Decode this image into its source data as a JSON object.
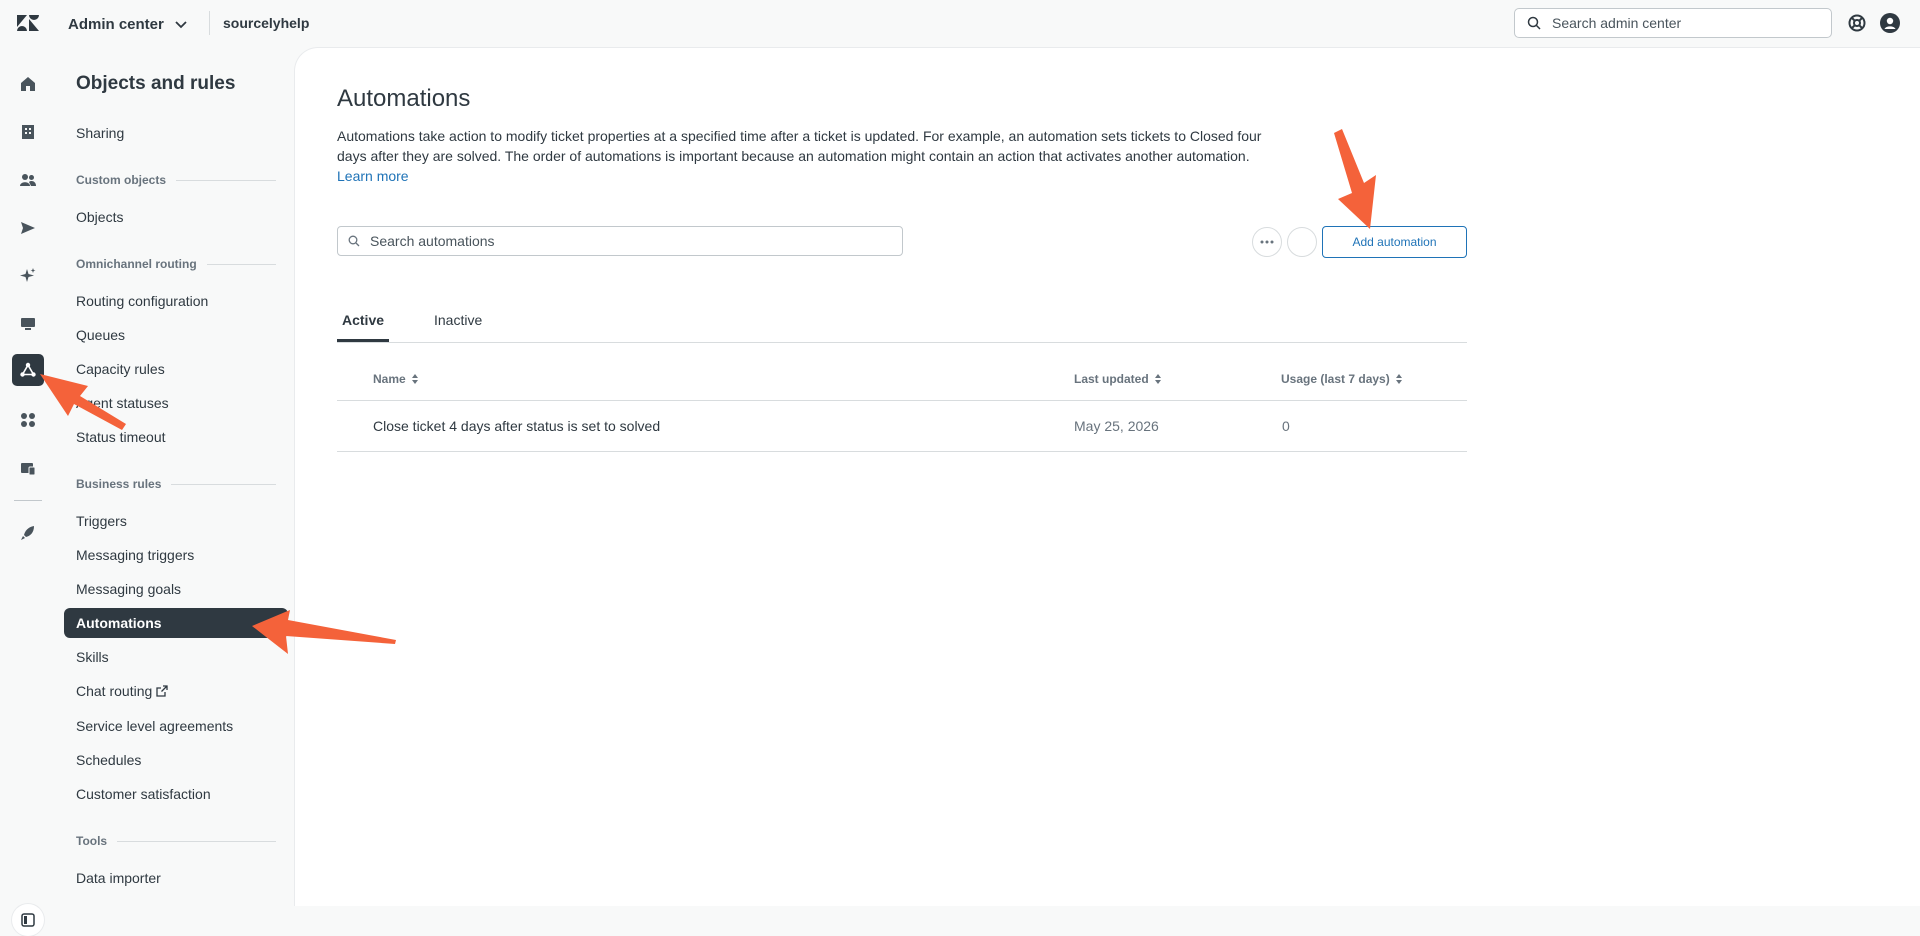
{
  "topbar": {
    "product": "Admin center",
    "subdomain": "sourcelyhelp",
    "search_placeholder": "Search admin center"
  },
  "rail": {
    "icons": [
      "home-icon",
      "building-icon",
      "people-icon",
      "send-icon",
      "sparkle-icon",
      "monitor-icon",
      "objects-rules-icon",
      "apps-icon",
      "workspace-icon",
      "rocket-icon"
    ],
    "active": "objects-rules-icon"
  },
  "secnav": {
    "title": "Objects and rules",
    "sharing": "Sharing",
    "custom_objects_header": "Custom objects",
    "objects": "Objects",
    "omnichannel_header": "Omnichannel routing",
    "routing_configuration": "Routing configuration",
    "queues": "Queues",
    "capacity_rules": "Capacity rules",
    "agent_statuses": "Agent statuses",
    "status_timeout": "Status timeout",
    "business_rules_header": "Business rules",
    "triggers": "Triggers",
    "messaging_triggers": "Messaging triggers",
    "messaging_goals": "Messaging goals",
    "automations": "Automations",
    "skills": "Skills",
    "chat_routing": "Chat routing",
    "sla": "Service level agreements",
    "schedules": "Schedules",
    "customer_satisfaction": "Customer satisfaction",
    "tools_header": "Tools",
    "data_importer": "Data importer"
  },
  "main": {
    "title": "Automations",
    "description": "Automations take action to modify ticket properties at a specified time after a ticket is updated. For example, an automation sets tickets to Closed four days after they are solved. The order of automations is important because an automation might contain an action that activates another automation.",
    "learn_more": "Learn more",
    "search_placeholder": "Search automations",
    "add_button": "Add automation",
    "tabs": {
      "active": "Active",
      "inactive": "Inactive"
    },
    "table": {
      "headers": {
        "name": "Name",
        "last_updated": "Last updated",
        "usage": "Usage (last 7 days)"
      },
      "rows": [
        {
          "name": "Close ticket 4 days after status is set to solved",
          "last_updated": "May 25, 2026",
          "usage": "0"
        }
      ]
    }
  },
  "colors": {
    "accent": "#1f73b7",
    "nav_selected": "#2f3941",
    "annotation_arrow": "#f4623a"
  }
}
